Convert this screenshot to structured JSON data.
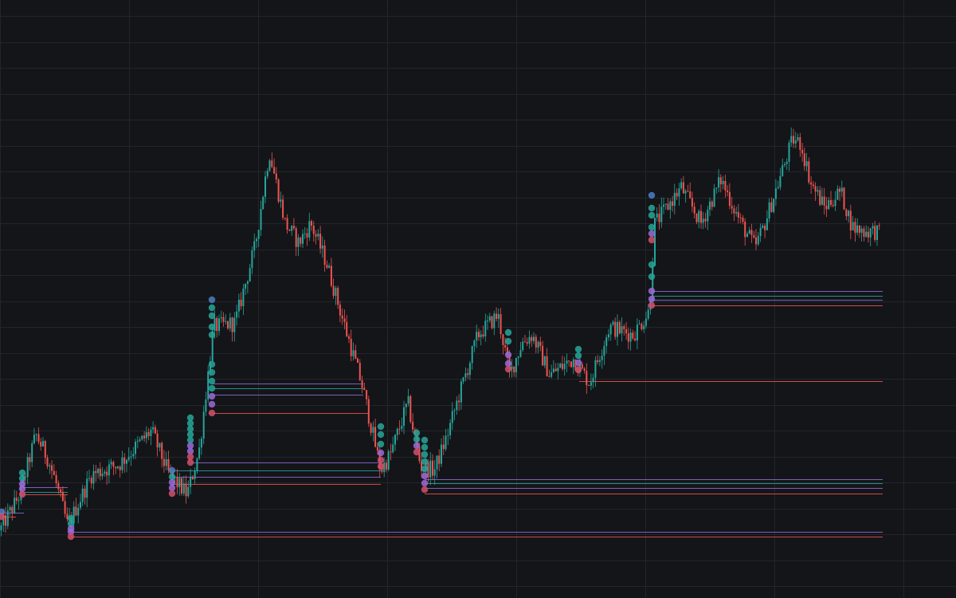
{
  "colors": {
    "background": "#141519",
    "grid": "#23252b",
    "up": "#26a69a",
    "down": "#ef5350",
    "level_purple": "#8e6ad8",
    "level_teal": "#26a69a",
    "level_red": "#ef5350",
    "dot_blue": "#4a7fc7",
    "dot_teal": "#26a69a",
    "dot_purple": "#9c6ad8",
    "dot_red": "#d2506a"
  },
  "chart_data": {
    "type": "candlestick",
    "title": "",
    "xlabel": "",
    "ylabel": "",
    "grid": true,
    "axes_visible": false,
    "ylim": [
      0,
      750
    ],
    "bar_count": 400,
    "price_path": [
      [
        0,
        85
      ],
      [
        25,
        130
      ],
      [
        45,
        205
      ],
      [
        60,
        175
      ],
      [
        70,
        145
      ],
      [
        85,
        90
      ],
      [
        115,
        155
      ],
      [
        150,
        168
      ],
      [
        190,
        210
      ],
      [
        212,
        155
      ],
      [
        235,
        130
      ],
      [
        250,
        185
      ],
      [
        268,
        340
      ],
      [
        295,
        345
      ],
      [
        320,
        440
      ],
      [
        338,
        560
      ],
      [
        358,
        470
      ],
      [
        375,
        445
      ],
      [
        390,
        470
      ],
      [
        410,
        420
      ],
      [
        430,
        350
      ],
      [
        455,
        265
      ],
      [
        478,
        160
      ],
      [
        490,
        180
      ],
      [
        512,
        245
      ],
      [
        528,
        165
      ],
      [
        545,
        160
      ],
      [
        560,
        200
      ],
      [
        575,
        250
      ],
      [
        600,
        330
      ],
      [
        625,
        355
      ],
      [
        640,
        280
      ],
      [
        655,
        320
      ],
      [
        668,
        330
      ],
      [
        690,
        280
      ],
      [
        720,
        300
      ],
      [
        740,
        270
      ],
      [
        765,
        340
      ],
      [
        795,
        330
      ],
      [
        815,
        360
      ],
      [
        822,
        470
      ],
      [
        830,
        480
      ],
      [
        855,
        515
      ],
      [
        880,
        470
      ],
      [
        905,
        525
      ],
      [
        930,
        470
      ],
      [
        948,
        440
      ],
      [
        960,
        470
      ],
      [
        980,
        530
      ],
      [
        995,
        575
      ],
      [
        1005,
        570
      ],
      [
        1018,
        520
      ],
      [
        1035,
        490
      ],
      [
        1055,
        510
      ],
      [
        1070,
        465
      ],
      [
        1085,
        460
      ],
      [
        1100,
        460
      ],
      [
        1105,
        455
      ]
    ],
    "liquidity_levels": [
      {
        "price": 107,
        "x_start": 0,
        "x_end": 30,
        "color": "purple"
      },
      {
        "price": 102,
        "x_start": 0,
        "x_end": 20,
        "color": "red"
      },
      {
        "price": 133,
        "x_start": 28,
        "x_end": 85,
        "color": "teal"
      },
      {
        "price": 139,
        "x_start": 28,
        "x_end": 85,
        "color": "purple"
      },
      {
        "price": 130,
        "x_start": 28,
        "x_end": 85,
        "color": "red"
      },
      {
        "price": 83,
        "x_start": 89,
        "x_end": 1108,
        "color": "purple"
      },
      {
        "price": 77,
        "x_start": 89,
        "x_end": 1108,
        "color": "red"
      },
      {
        "price": 170,
        "x_start": 239,
        "x_end": 478,
        "color": "purple"
      },
      {
        "price": 160,
        "x_start": 216,
        "x_end": 478,
        "color": "teal"
      },
      {
        "price": 152,
        "x_start": 216,
        "x_end": 478,
        "color": "purple"
      },
      {
        "price": 143,
        "x_start": 216,
        "x_end": 478,
        "color": "red"
      },
      {
        "price": 269,
        "x_start": 267,
        "x_end": 456,
        "color": "purple"
      },
      {
        "price": 263,
        "x_start": 267,
        "x_end": 456,
        "color": "teal"
      },
      {
        "price": 255,
        "x_start": 267,
        "x_end": 456,
        "color": "purple"
      },
      {
        "price": 232,
        "x_start": 262,
        "x_end": 462,
        "color": "red"
      },
      {
        "price": 149,
        "x_start": 533,
        "x_end": 1108,
        "color": "purple"
      },
      {
        "price": 144,
        "x_start": 533,
        "x_end": 1108,
        "color": "teal"
      },
      {
        "price": 138,
        "x_start": 533,
        "x_end": 1108,
        "color": "purple"
      },
      {
        "price": 131,
        "x_start": 533,
        "x_end": 1108,
        "color": "red"
      },
      {
        "price": 272,
        "x_start": 727,
        "x_end": 1108,
        "color": "red"
      },
      {
        "price": 385,
        "x_start": 818,
        "x_end": 1108,
        "color": "purple"
      },
      {
        "price": 379,
        "x_start": 818,
        "x_end": 1108,
        "color": "teal"
      },
      {
        "price": 374,
        "x_start": 818,
        "x_end": 1108,
        "color": "purple"
      },
      {
        "price": 367,
        "x_start": 818,
        "x_end": 1108,
        "color": "red"
      }
    ],
    "marker_stacks": [
      {
        "x": 2,
        "prices": [
          108,
          102
        ],
        "colors": [
          "blue",
          "red"
        ]
      },
      {
        "x": 28,
        "prices": [
          157,
          150,
          143,
          137,
          130
        ],
        "colors": [
          "teal",
          "teal",
          "purple",
          "purple",
          "red"
        ]
      },
      {
        "x": 89,
        "prices": [
          100,
          93,
          87,
          83,
          77
        ],
        "colors": [
          "teal",
          "teal",
          "purple",
          "purple",
          "red"
        ]
      },
      {
        "x": 216,
        "prices": [
          160,
          152,
          145,
          138,
          131
        ],
        "colors": [
          "blue",
          "teal",
          "purple",
          "purple",
          "red"
        ]
      },
      {
        "x": 239,
        "prices": [
          226,
          219,
          212,
          205,
          198,
          191,
          184,
          177,
          170
        ],
        "colors": [
          "teal",
          "teal",
          "teal",
          "teal",
          "teal",
          "purple",
          "purple",
          "red",
          "red"
        ]
      },
      {
        "x": 266,
        "prices": [
          374,
          364,
          354,
          340,
          330,
          293,
          283,
          272,
          263,
          253,
          243,
          232
        ],
        "colors": [
          "blue",
          "teal",
          "teal",
          "teal",
          "teal",
          "teal",
          "teal",
          "teal",
          "teal",
          "purple",
          "purple",
          "red"
        ]
      },
      {
        "x": 478,
        "prices": [
          215,
          205,
          193,
          182,
          173,
          165
        ],
        "colors": [
          "teal",
          "teal",
          "teal",
          "purple",
          "red",
          "red"
        ]
      },
      {
        "x": 523,
        "prices": [
          207,
          199,
          191,
          183
        ],
        "colors": [
          "teal",
          "teal",
          "purple",
          "red"
        ]
      },
      {
        "x": 533,
        "prices": [
          198,
          189,
          180,
          171,
          162,
          153,
          144,
          136
        ],
        "colors": [
          "teal",
          "teal",
          "teal",
          "teal",
          "teal",
          "purple",
          "purple",
          "red"
        ]
      },
      {
        "x": 638,
        "prices": [
          333,
          322,
          305,
          294,
          287
        ],
        "colors": [
          "teal",
          "teal",
          "purple",
          "purple",
          "red"
        ]
      },
      {
        "x": 726,
        "prices": [
          312,
          304,
          295,
          286
        ],
        "colors": [
          "teal",
          "teal",
          "purple",
          "red"
        ]
      },
      {
        "x": 818,
        "prices": [
          505,
          489,
          480,
          465,
          457,
          449,
          418,
          403,
          385,
          375,
          367
        ],
        "colors": [
          "blue",
          "teal",
          "teal",
          "teal",
          "purple",
          "red",
          "teal",
          "teal",
          "purple",
          "purple",
          "red"
        ]
      }
    ]
  }
}
